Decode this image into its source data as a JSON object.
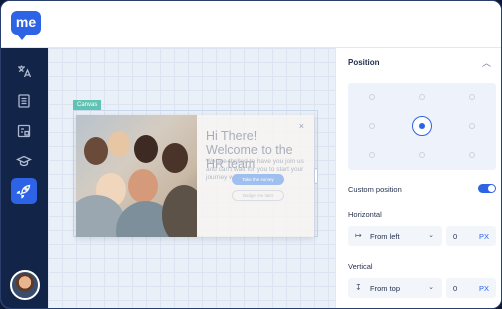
{
  "app": {
    "logo_text": "me"
  },
  "sidebar": {
    "items": [
      {
        "icon": "translate-icon"
      },
      {
        "icon": "document-icon"
      },
      {
        "icon": "gallery-icon"
      },
      {
        "icon": "graduation-cap-icon"
      },
      {
        "icon": "rocket-icon",
        "active": true
      }
    ],
    "avatar": "user-avatar"
  },
  "canvas": {
    "tag": "Canvas",
    "popup": {
      "title": "Hi There! Welcome to the HR team",
      "body": "We are thrilled to have you join us and can't wait for you to start your journey with us.",
      "primary_button": "Take the survey",
      "secondary_button": "Nudge me later",
      "close": "×"
    }
  },
  "panel": {
    "title": "Position",
    "selected_position": "middle-center",
    "custom_position_label": "Custom position",
    "custom_position_enabled": true,
    "horizontal": {
      "label": "Horizontal",
      "mode": "From left",
      "value": "0",
      "unit": "PX"
    },
    "vertical": {
      "label": "Vertical",
      "mode": "From top",
      "value": "0",
      "unit": "PX"
    }
  },
  "colors": {
    "accent": "#2d64e6",
    "sidebar_bg": "#132449",
    "canvas_bg": "#eaf0f8",
    "tag_bg": "#5fc3b3"
  }
}
